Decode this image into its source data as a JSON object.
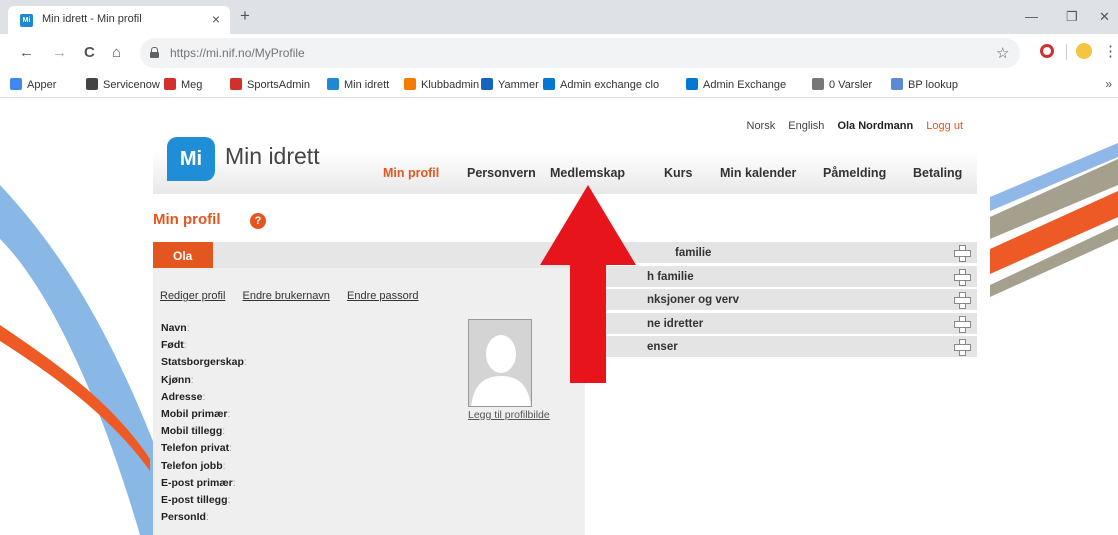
{
  "browser": {
    "tab_title": "Min idrett - Min profil",
    "tab_close": "×",
    "new_tab": "+",
    "url_host": "https://mi.nif.no",
    "url_path": "/MyProfile",
    "window": {
      "minimize": "—",
      "restore": "❐",
      "close": "✕"
    },
    "nav": {
      "back": "←",
      "forward": "→",
      "reload": "C",
      "home": "⌂"
    },
    "star": "☆",
    "menu": "⋮",
    "bookmarks": [
      {
        "label": "Apper",
        "icon": "apps-icon",
        "color": "#4285f4"
      },
      {
        "label": "Servicenow",
        "icon": "servicenow-icon",
        "color": "#444444"
      },
      {
        "label": "Meg",
        "icon": "meg-icon",
        "color": "#d32f2f"
      },
      {
        "label": "SportsAdmin",
        "icon": "sportsadmin-icon",
        "color": "#d32f2f"
      },
      {
        "label": "Min idrett",
        "icon": "minidrett-icon",
        "color": "#1e88d2"
      },
      {
        "label": "Klubbadmin",
        "icon": "klubbadmin-icon",
        "color": "#f57c00"
      },
      {
        "label": "Yammer",
        "icon": "yammer-icon",
        "color": "#1565c0"
      },
      {
        "label": "Admin exchange clo",
        "icon": "exchange-icon",
        "color": "#0078d4"
      },
      {
        "label": "Admin Exchange",
        "icon": "outlook-icon",
        "color": "#0078d4"
      },
      {
        "label": "0 Varsler",
        "icon": "page-icon",
        "color": "#777777"
      },
      {
        "label": "BP lookup",
        "icon": "lookup-icon",
        "color": "#5b8bd4"
      }
    ],
    "bookmarks_more": "»"
  },
  "site": {
    "logo_badge": "Mi",
    "logo_text": "Min idrett",
    "top_links": {
      "lang_no": "Norsk",
      "lang_en": "English",
      "user": "Ola Nordmann",
      "logout": "Logg ut"
    },
    "nav": [
      "Min profil",
      "Personvern",
      "Medlemskap",
      "Kurs",
      "Min kalender",
      "Påmelding",
      "Betaling"
    ],
    "active_nav": "Min profil",
    "page_title": "Min profil",
    "help": "?",
    "profile": {
      "name_tab": "Ola",
      "links": [
        "Rediger profil",
        "Endre brukernavn",
        "Endre passord"
      ],
      "fields": [
        "Navn",
        "Født",
        "Statsborgerskap",
        "Kjønn",
        "Adresse",
        "Mobil primær",
        "Mobil tillegg",
        "Telefon privat",
        "Telefon jobb",
        "E-post primær",
        "E-post tillegg",
        "PersonId"
      ],
      "colon": ":",
      "avatar_link": "Legg til profilbilde"
    },
    "accordion": [
      "familie",
      "h familie",
      "nksjoner og verv",
      "ne idretter",
      "enser"
    ],
    "colors": {
      "accent": "#e4561f",
      "logo": "#1f8ed6",
      "arrow": "#e8141c"
    }
  }
}
